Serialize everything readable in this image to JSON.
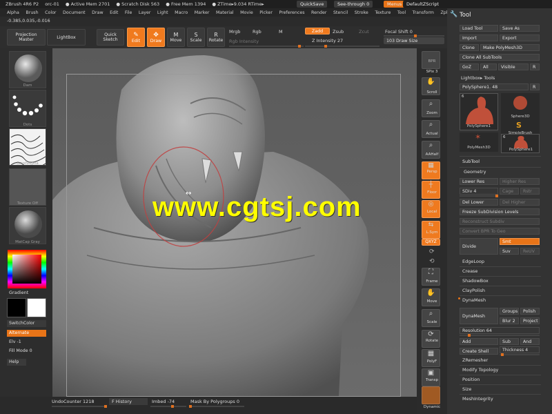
{
  "titlebar": {
    "app": "ZBrush 4R6 P2",
    "doc": "orc-01",
    "active_mem": "● Active Mem 2701",
    "scratch": "● Scratch Disk 563",
    "free_mem": "● Free Mem 1394",
    "ztime": "● ZTime▸9.034 RTime▸",
    "quicksave": "QuickSave",
    "seethrough": "See-through  0",
    "menus": "Menus",
    "script": "DefaultZScript"
  },
  "menu": [
    "Alpha",
    "Brush",
    "Color",
    "Document",
    "Draw",
    "Edit",
    "File",
    "Layer",
    "Light",
    "Macro",
    "Marker",
    "Material",
    "Movie",
    "Picker",
    "Preferences",
    "Render",
    "Stencil",
    "Stroke",
    "Texture",
    "Tool",
    "Transform",
    "Zplugin",
    "Zscript"
  ],
  "coords": "-0.385,0.035,-0.016",
  "toolbar": {
    "projection": "Projection Master",
    "lightbox": "LightBox",
    "quicksketch": "Quick Sketch",
    "edit": "Edit",
    "draw": "Draw",
    "move": "Move",
    "scale": "Scale",
    "rotate": "Rotate",
    "mrgb": "Mrgb",
    "rgb": "Rgb",
    "m": "M",
    "rgb_intensity": "Rgb Intensity",
    "zadd": "Zadd",
    "zsub": "Zsub",
    "zcut": "Zcut",
    "z_intensity": "Z Intensity 27",
    "focal_shift": "Focal Shift 0",
    "draw_size": "103  Draw Size"
  },
  "left": {
    "brush_label": "Dam",
    "stroke_label": "Dots",
    "alpha_label": "BrushAlpha",
    "texture_label": "Texture Off",
    "material_label": "MatCap Gray",
    "gradient": "Gradient",
    "switchcolor": "SwitchColor",
    "alternate": "Alternate",
    "elv": "Elv -1",
    "fillmode": "Fill Mode 0",
    "help": "Help"
  },
  "viewport": {
    "watermark": "www.cgtsj.com"
  },
  "rightshelf": {
    "bpr": "BPR",
    "spix": "SPix 3",
    "scroll": "Scroll",
    "zoom": "Zoom",
    "actual": "Actual",
    "aahalf": "AAHalf",
    "persp": "Persp",
    "floor": "Floor",
    "local": "Local",
    "lsym": "L.Sym",
    "xyz": "QXYZ",
    "frame": "Frame",
    "move": "Move",
    "scale": "Scale",
    "rotate": "Rotate",
    "polyf": "PolyF",
    "transp": "Transp",
    "dynamic": "Dynamic"
  },
  "bottom": {
    "undocounter": "UndoCounter 1218",
    "history": "F History",
    "imbed": "Imbed -74",
    "mask_by_polygroups": "Mask By Polygroups 0"
  },
  "tool": {
    "title": "Tool",
    "load": "Load Tool",
    "save_as": "Save As",
    "import": "Import",
    "export": "Export",
    "clone": "Clone",
    "make_polymesh": "Make PolyMesh3D",
    "clone_all": "Clone All SubTools",
    "goz": "GoZ",
    "all": "All",
    "visible": "Visible",
    "r": "R",
    "lightbox_tools": "Lightbox▸ Tools",
    "current_tool": "PolySphere1. 48",
    "r2": "R",
    "tools": [
      {
        "label": "PolySphere1",
        "badge": "6"
      },
      {
        "label": "Sphere3D",
        "badge": ""
      },
      {
        "label": "SimpleBrush",
        "badge": ""
      },
      {
        "label": "PolyMesh3D",
        "badge": ""
      },
      {
        "label": "PolySphere1",
        "badge": "6"
      }
    ],
    "subtool": "SubTool",
    "geometry": "Geometry",
    "lower_res": "Lower Res",
    "higher_res": "Higher Res",
    "sdiv": "SDiv 4",
    "cage": "Cage",
    "rstr": "Rstr",
    "del_lower": "Del Lower",
    "del_higher": "Del Higher",
    "freeze": "Freeze SubDivision Levels",
    "reconstruct": "Reconstruct Subdiv",
    "convert_bpr": "Convert BPR To Geo",
    "divide": "Divide",
    "smt": "Smt",
    "suv": "Suv",
    "reuv": "ReUV",
    "edgeloop": "EdgeLoop",
    "crease": "Crease",
    "shadowbox": "ShadowBox",
    "claypolish": "ClayPolish",
    "dynamesh_header": "DynaMesh",
    "dynamesh": "DynaMesh",
    "groups": "Groups",
    "polish": "Polish",
    "blur": "Blur 2",
    "project": "Project",
    "resolution": "Resolution 64",
    "add": "Add",
    "sub": "Sub",
    "and": "And",
    "create_shell": "Create Shell",
    "thickness": "Thickness 4",
    "zremesher": "ZRemesher",
    "modify_topology": "Modify Topology",
    "position": "Position",
    "size": "Size",
    "meshintegrity": "MeshIntegrity"
  }
}
